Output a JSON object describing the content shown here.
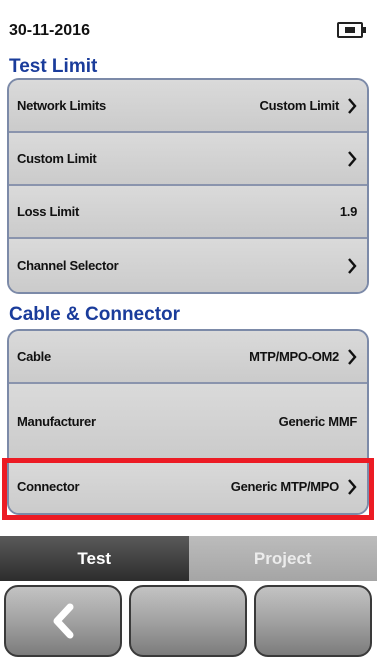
{
  "status": {
    "date": "30-11-2016",
    "battery_icon": "battery-icon"
  },
  "test_limit": {
    "title": "Test Limit",
    "rows": [
      {
        "label": "Network Limits",
        "value": "Custom Limit",
        "chevron": true
      },
      {
        "label": "Custom Limit",
        "value": "",
        "chevron": true
      },
      {
        "label": "Loss Limit",
        "value": "1.9",
        "chevron": false
      },
      {
        "label": "Channel Selector",
        "value": "",
        "chevron": true
      }
    ]
  },
  "cable_connector": {
    "title": "Cable & Connector",
    "rows": [
      {
        "label": "Cable",
        "value": "MTP/MPO-OM2",
        "chevron": true
      },
      {
        "label": "Manufacturer",
        "value": "Generic MMF",
        "chevron": false
      },
      {
        "label": "Connector",
        "value": "Generic MTP/MPO",
        "chevron": true
      }
    ]
  },
  "tabs": {
    "test": "Test",
    "project": "Project"
  },
  "softkeys": [
    {
      "icon": "back-arrow-icon"
    },
    {
      "icon": ""
    },
    {
      "icon": ""
    }
  ],
  "colors": {
    "section_title": "#1a3c9b",
    "highlight": "#ec1b24"
  }
}
